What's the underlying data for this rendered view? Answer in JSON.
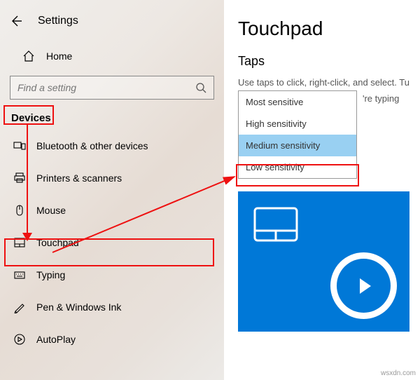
{
  "header": {
    "title": "Settings"
  },
  "home": {
    "label": "Home"
  },
  "search": {
    "placeholder": "Find a setting"
  },
  "category": {
    "label": "Devices"
  },
  "nav": {
    "bluetooth": "Bluetooth & other devices",
    "printers": "Printers & scanners",
    "mouse": "Mouse",
    "touchpad": "Touchpad",
    "typing": "Typing",
    "pen": "Pen & Windows Ink",
    "autoplay": "AutoPlay"
  },
  "main": {
    "title": "Touchpad",
    "section": "Taps",
    "desc_line1": "Use taps to click, right-click, and select. Tu",
    "desc_line2_tail": "'re typing"
  },
  "dropdown": {
    "items": [
      "Most sensitive",
      "High sensitivity",
      "Medium sensitivity",
      "Low sensitivity"
    ],
    "selected_index": 2
  },
  "watermark": "wsxdn.com"
}
